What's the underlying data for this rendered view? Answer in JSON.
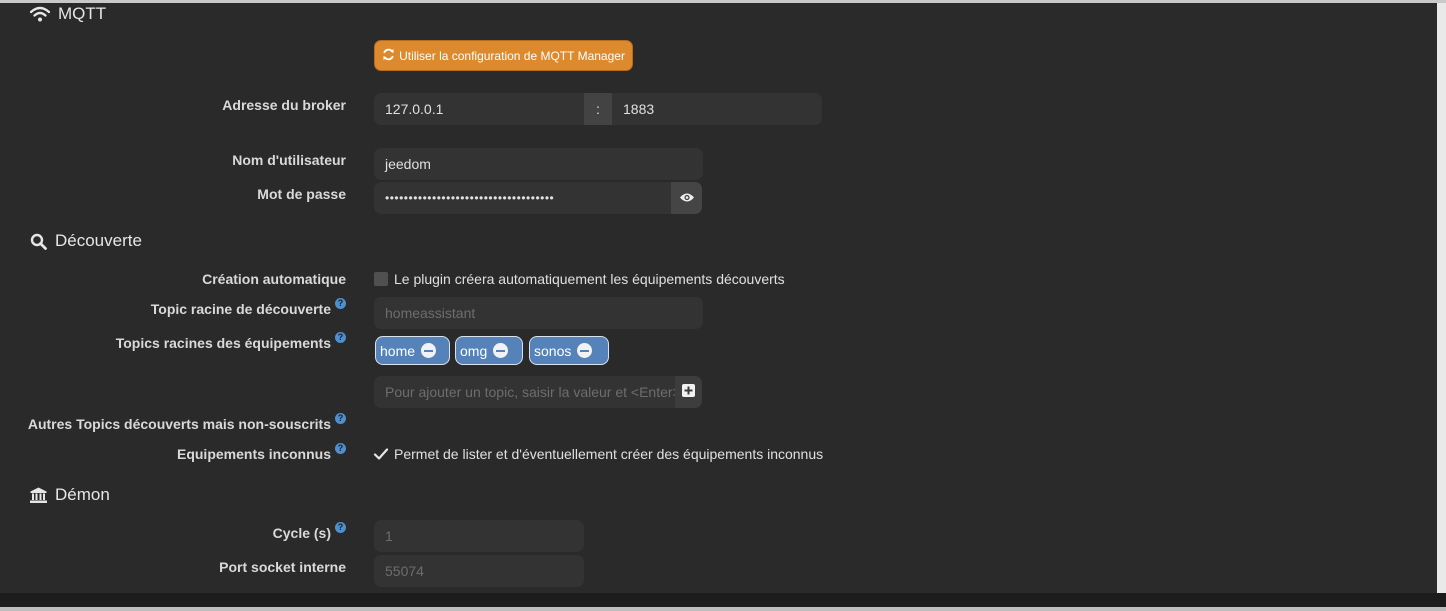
{
  "sections": {
    "mqtt": {
      "title": "MQTT",
      "icon": "wifi-icon"
    },
    "discovery": {
      "title": "Découverte",
      "icon": "search-icon"
    },
    "daemon": {
      "title": "Démon",
      "icon": "bank-icon"
    }
  },
  "mqtt": {
    "use_manager_button": "Utiliser la configuration de MQTT Manager",
    "broker_label": "Adresse du broker",
    "broker_host": "127.0.0.1",
    "broker_separator": ":",
    "broker_port": "1883",
    "username_label": "Nom d'utilisateur",
    "username_value": "jeedom",
    "password_label": "Mot de passe",
    "password_value": "••••••••••••••••••••••••••••••••••••"
  },
  "discovery": {
    "auto_create_label": "Création automatique",
    "auto_create_text": "Le plugin créera automatiquement les équipements découverts",
    "auto_create_checked": false,
    "root_topic_label": "Topic racine de découverte",
    "root_topic_placeholder": "homeassistant",
    "equipment_topics_label": "Topics racines des équipements",
    "equipment_topics": [
      "home",
      "omg",
      "sonos"
    ],
    "add_topic_placeholder": "Pour ajouter un topic, saisir la valeur et <Enter>",
    "other_topics_label": "Autres Topics découverts mais non-souscrits",
    "unknown_equipment_label": "Equipements inconnus",
    "unknown_equipment_text": "Permet de lister et d'éventuellement créer des équipements inconnus",
    "unknown_equipment_checked": true
  },
  "daemon": {
    "cycle_label": "Cycle (s)",
    "cycle_value": "1",
    "socket_port_label": "Port socket interne",
    "socket_port_value": "55074"
  },
  "help_glyph": "?",
  "colors": {
    "panel_bg": "#2a2a2a",
    "field_bg": "#333333",
    "accent_orange": "#dd8a2e",
    "tag_blue": "#5582b8",
    "help_blue": "#4d8fd1"
  }
}
